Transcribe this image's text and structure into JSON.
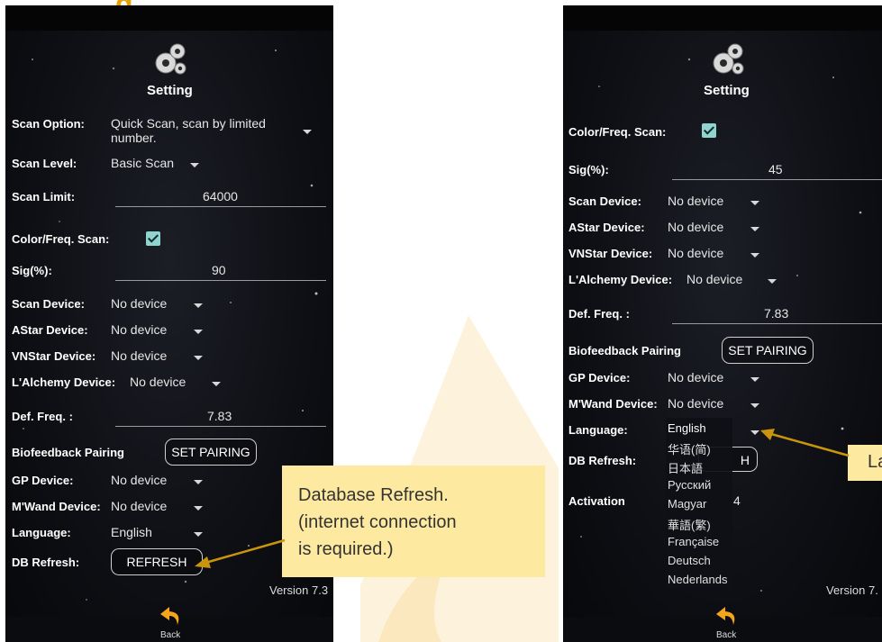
{
  "heading_fragment": "g",
  "left_screen": {
    "title": "Setting",
    "rows": {
      "scan_option_label": "Scan Option:",
      "scan_option_value_line1": "Quick Scan, scan by limited",
      "scan_option_value_line2": "number.",
      "scan_level_label": "Scan Level:",
      "scan_level_value": "Basic Scan",
      "scan_limit_label": "Scan Limit:",
      "scan_limit_value": "64000",
      "color_freq_label": "Color/Freq. Scan:",
      "sig_label": "Sig(%):",
      "sig_value": "90",
      "scan_device_label": "Scan Device:",
      "scan_device_value": "No device",
      "astar_label": "AStar Device:",
      "astar_value": "No device",
      "vnstar_label": "VNStar Device:",
      "vnstar_value": "No device",
      "lalchemy_label": "L'Alchemy Device:",
      "lalchemy_value": "No device",
      "def_freq_label": "Def. Freq. :",
      "def_freq_value": "7.83",
      "biofeedback_label": "Biofeedback Pairing",
      "set_pairing_button": "SET PAIRING",
      "gp_label": "GP Device:",
      "gp_value": "No device",
      "mwand_label": "M'Wand Device:",
      "mwand_value": "No device",
      "language_label": "Language:",
      "language_value": "English",
      "db_refresh_label": "DB Refresh:",
      "refresh_button": "REFRESH"
    },
    "version": "Version 7.3",
    "back_label": "Back"
  },
  "right_screen": {
    "title": "Setting",
    "rows": {
      "color_freq_label": "Color/Freq. Scan:",
      "sig_label": "Sig(%):",
      "sig_value": "45",
      "scan_device_label": "Scan Device:",
      "scan_device_value": "No device",
      "astar_label": "AStar Device:",
      "astar_value": "No device",
      "vnstar_label": "VNStar Device:",
      "vnstar_value": "No device",
      "lalchemy_label": "L'Alchemy Device:",
      "lalchemy_value": "No device",
      "def_freq_label": "Def. Freq. :",
      "def_freq_value": "7.83",
      "biofeedback_label": "Biofeedback Pairing",
      "set_pairing_button": "SET PAIRING",
      "gp_label": "GP Device:",
      "gp_value": "No device",
      "mwand_label": "M'Wand Device:",
      "mwand_value": "No device",
      "language_label": "Language:",
      "db_refresh_label": "DB Refresh:",
      "refresh_button_fragment": "H",
      "activation_label": "Activation",
      "activation_value_fragment": "4"
    },
    "language_options": [
      "English",
      "华语(简)",
      "日本語",
      "Русский",
      "Magyar",
      "華語(繁)",
      "Française",
      "Deutsch",
      "Nederlands"
    ],
    "language_selected": "English",
    "version": "Version 7.",
    "back_label": "Back"
  },
  "callouts": {
    "db_refresh_line1": "Database Refresh.",
    "db_refresh_line2": "(internet connection",
    "db_refresh_line3": "is required.)",
    "language_fragment": "La"
  },
  "colors": {
    "accent_checkbox": "#8fd4cf",
    "callout_bg": "#fde9a0",
    "arrow": "#c8950c",
    "heading": "#e4a400"
  },
  "icons": {
    "settings": "gear-icon",
    "dropdown": "chevron-down-icon",
    "back": "back-arrow-icon",
    "checkbox": "checkbox-checked-icon"
  }
}
